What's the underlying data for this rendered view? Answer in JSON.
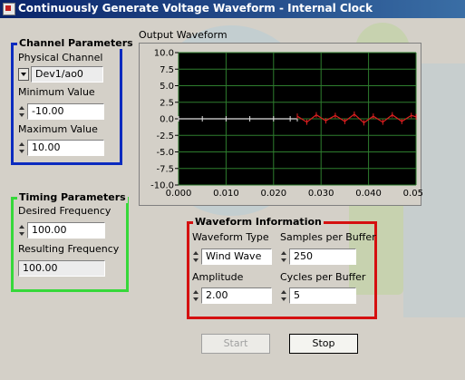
{
  "window": {
    "title": "Continuously Generate Voltage Waveform - Internal Clock"
  },
  "channel": {
    "group_title": "Channel Parameters",
    "physical_channel_label": "Physical Channel",
    "physical_channel_value": "Dev1/ao0",
    "min_label": "Minimum Value",
    "min_value": "-10.00",
    "max_label": "Maximum Value",
    "max_value": "10.00"
  },
  "timing": {
    "group_title": "Timing Parameters",
    "desired_label": "Desired Frequency",
    "desired_value": "100.00",
    "resulting_label": "Resulting Frequency",
    "resulting_value": "100.00"
  },
  "waveform": {
    "group_title": "Waveform Information",
    "type_label": "Waveform Type",
    "type_value": "Wind Wave",
    "samples_label": "Samples per Buffer",
    "samples_value": "250",
    "amplitude_label": "Amplitude",
    "amplitude_value": "2.00",
    "cycles_label": "Cycles per Buffer",
    "cycles_value": "5"
  },
  "buttons": {
    "start": "Start",
    "stop": "Stop"
  },
  "chart_data": {
    "type": "line",
    "title": "Output Waveform",
    "xlim": [
      0.0,
      0.05
    ],
    "ylim": [
      -10.0,
      10.0
    ],
    "x_ticks": [
      "0.000",
      "0.010",
      "0.020",
      "0.030",
      "0.040",
      "0.050"
    ],
    "y_ticks": [
      "10.0",
      "7.5",
      "5.0",
      "2.5",
      "0.0",
      "-2.5",
      "-5.0",
      "-7.5",
      "-10.0"
    ],
    "grid": true,
    "background": "#000000",
    "grid_color": "#2e7d2e",
    "series": [
      {
        "color": "#e0e0e0",
        "x": [
          0.0,
          0.005,
          0.01,
          0.015,
          0.02,
          0.0235,
          0.025
        ],
        "y": [
          0.0,
          0.0,
          0.0,
          0.0,
          0.0,
          0.0,
          0.0
        ]
      },
      {
        "color": "#e02020",
        "x": [
          0.025,
          0.027,
          0.029,
          0.031,
          0.033,
          0.035,
          0.037,
          0.039,
          0.041,
          0.043,
          0.045,
          0.047,
          0.049,
          0.05
        ],
        "y": [
          0.4,
          -0.5,
          0.6,
          -0.3,
          0.5,
          -0.4,
          0.7,
          -0.6,
          0.4,
          -0.5,
          0.6,
          -0.4,
          0.5,
          0.3
        ]
      }
    ]
  }
}
